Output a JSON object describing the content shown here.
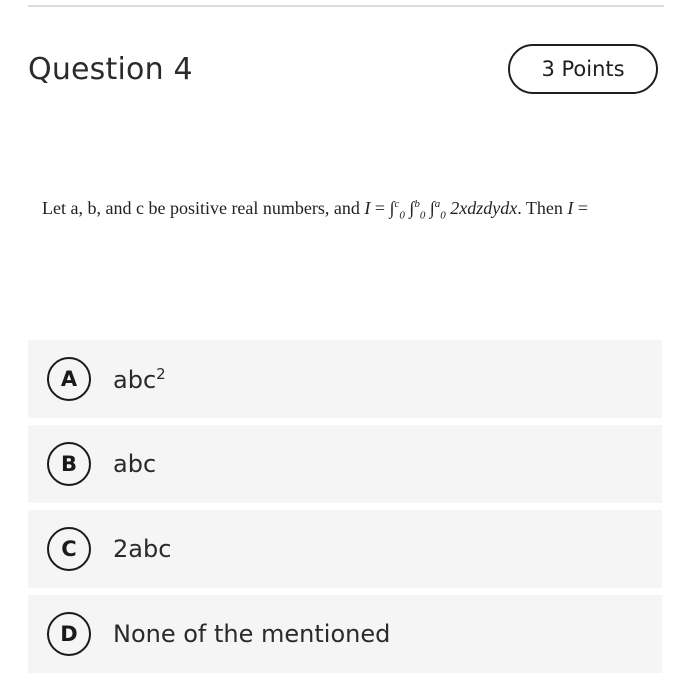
{
  "question": {
    "title": "Question 4",
    "points": "3 Points",
    "stem_prefix": "Let a, b, and c be positive real numbers, and ",
    "stem_var": "I",
    "stem_eq": " = ",
    "stem_integrand": "2xdzdydx",
    "stem_suffix": ". Then ",
    "stem_end_var": "I",
    "stem_end_eq": " ="
  },
  "options": [
    {
      "letter": "A",
      "text": "abc",
      "sup": "2"
    },
    {
      "letter": "B",
      "text": "abc",
      "sup": ""
    },
    {
      "letter": "C",
      "text": "2abc",
      "sup": ""
    },
    {
      "letter": "D",
      "text": "None of the mentioned",
      "sup": ""
    }
  ],
  "integrals": [
    {
      "upper": "c",
      "lower": "0"
    },
    {
      "upper": "b",
      "lower": "0"
    },
    {
      "upper": "a",
      "lower": "0"
    }
  ]
}
